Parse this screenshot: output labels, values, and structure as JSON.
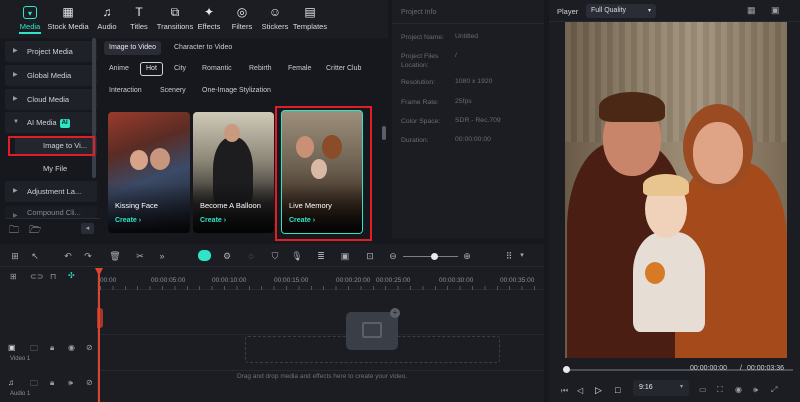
{
  "toolbar": {
    "tabs": [
      {
        "label": "Media",
        "icon": "media-icon"
      },
      {
        "label": "Stock Media",
        "icon": "stock-media-icon"
      },
      {
        "label": "Audio",
        "icon": "audio-icon"
      },
      {
        "label": "Titles",
        "icon": "titles-icon"
      },
      {
        "label": "Transitions",
        "icon": "transitions-icon"
      },
      {
        "label": "Effects",
        "icon": "effects-icon"
      },
      {
        "label": "Filters",
        "icon": "filters-icon"
      },
      {
        "label": "Stickers",
        "icon": "stickers-icon"
      },
      {
        "label": "Templates",
        "icon": "templates-icon"
      }
    ]
  },
  "sidebar": {
    "items": [
      "Project Media",
      "Global Media",
      "Cloud Media",
      "AI Media",
      "Adjustment La...",
      "Compound Cli..."
    ],
    "ai_badge": "AI",
    "sub_items": [
      "Image to Vi...",
      "My File"
    ]
  },
  "library": {
    "tabs": [
      "Image to Video",
      "Character to Video"
    ],
    "tags_row1": [
      "Anime",
      "Hot",
      "City",
      "Romantic",
      "Rebirth",
      "Female",
      "Critter Club"
    ],
    "tags_row2": [
      "Interaction",
      "Scenery",
      "One-Image Stylization"
    ],
    "cards": [
      {
        "label": "Kissing Face",
        "cta": "Create"
      },
      {
        "label": "Become A Balloon",
        "cta": "Create"
      },
      {
        "label": "Live Memory",
        "cta": "Create"
      }
    ]
  },
  "project_info": {
    "title": "Project Info",
    "rows": [
      {
        "label": "Project Name:",
        "value": "Untitled"
      },
      {
        "label": "Project Files Location:",
        "value": "/"
      },
      {
        "label": "Resolution:",
        "value": "1080 x 1920"
      },
      {
        "label": "Frame Rate:",
        "value": "25fps"
      },
      {
        "label": "Color Space:",
        "value": "SDR - Rec.709"
      },
      {
        "label": "Duration:",
        "value": "00:00:00:00"
      }
    ]
  },
  "player": {
    "label": "Player",
    "quality": "Full Quality",
    "time_current": "00:00:00:00",
    "time_sep": "/",
    "time_total": "00:00:03:36",
    "aspect": "9:16",
    "progress_fraction": 0.0
  },
  "timeline": {
    "ruler": [
      "00:00",
      "00:00:05:00",
      "00:00:10:00",
      "00:00:15:00",
      "00:00:20:00",
      "00:00:25:00",
      "00:00:30:00",
      "00:00:35:00"
    ],
    "tracks": [
      {
        "label": "Video 1"
      },
      {
        "label": "Audio 1"
      }
    ],
    "drop_hint": "Drag and drop media and effects here to create your video."
  },
  "colors": {
    "accent": "#2ee6c6",
    "highlight": "#e01e26",
    "panel": "#1b1d23",
    "background": "#16181d"
  }
}
